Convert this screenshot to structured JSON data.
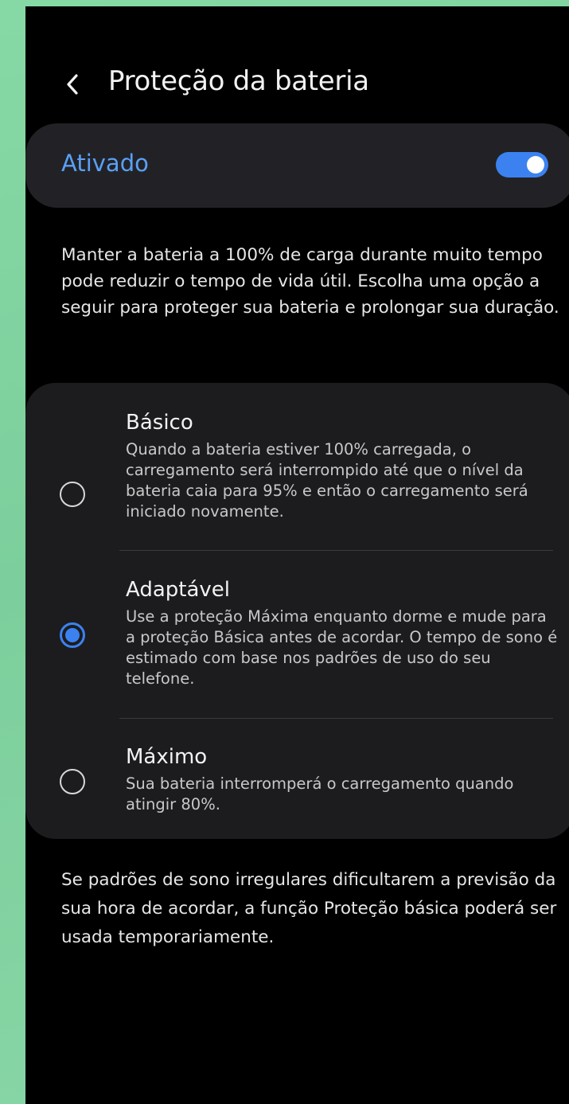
{
  "header": {
    "back_icon": "chevron-left-icon",
    "title": "Proteção da bateria"
  },
  "master_switch": {
    "label": "Ativado",
    "state": "on",
    "accent_color": "#3b82f0"
  },
  "description": "Manter a bateria a 100% de carga durante muito tempo pode reduzir o tempo de vida útil. Escolha uma opção a seguir para proteger sua bateria e prolongar sua duração.",
  "options": [
    {
      "title": "Básico",
      "description": "Quando a bateria estiver 100% carregada, o carregamento será interrompido até que o nível da bateria caia para 95% e então o carregamento será iniciado novamente.",
      "selected": false
    },
    {
      "title": "Adaptável",
      "description": "Use a proteção Máxima enquanto dorme e mude para a proteção Básica antes de acordar. O tempo de sono é estimado com base nos padrões de uso do seu telefone.",
      "selected": true
    },
    {
      "title": "Máximo",
      "description": "Sua bateria interromperá o carregamento quando atingir 80%.",
      "selected": false
    }
  ],
  "footer_note": "Se padrões de sono irregulares dificultarem a previsão da sua hora de acordar, a função Proteção básica poderá ser usada temporariamente."
}
